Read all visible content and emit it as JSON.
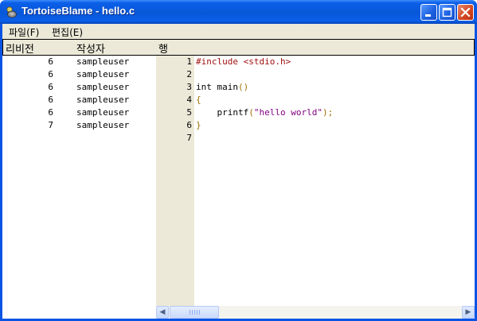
{
  "window": {
    "title": "TortoiseBlame - hello.c"
  },
  "menu": {
    "file": "파일(F)",
    "edit": "편집(E)"
  },
  "columns": {
    "revision": "리비전",
    "author": "작성자",
    "line": "행"
  },
  "blame_rows": [
    {
      "revision": "6",
      "author": "sampleuser"
    },
    {
      "revision": "6",
      "author": "sampleuser"
    },
    {
      "revision": "6",
      "author": "sampleuser"
    },
    {
      "revision": "6",
      "author": "sampleuser"
    },
    {
      "revision": "6",
      "author": "sampleuser"
    },
    {
      "revision": "7",
      "author": "sampleuser"
    }
  ],
  "line_numbers": [
    "1",
    "2",
    "3",
    "4",
    "5",
    "6",
    "7"
  ],
  "code_lines": [
    "#include <stdio.h>",
    "",
    "int main()",
    "{",
    "    printf(\"hello world\");",
    "}",
    ""
  ],
  "colors": {
    "titlebar": "#0a5fe8",
    "client_bg": "#ece9d8",
    "preprocessor": "#a01010",
    "string": "#800080",
    "operator": "#a07000"
  },
  "icons": {
    "app": "tortoise-icon",
    "minimize": "minimize-icon",
    "maximize": "maximize-icon",
    "close": "close-icon"
  }
}
